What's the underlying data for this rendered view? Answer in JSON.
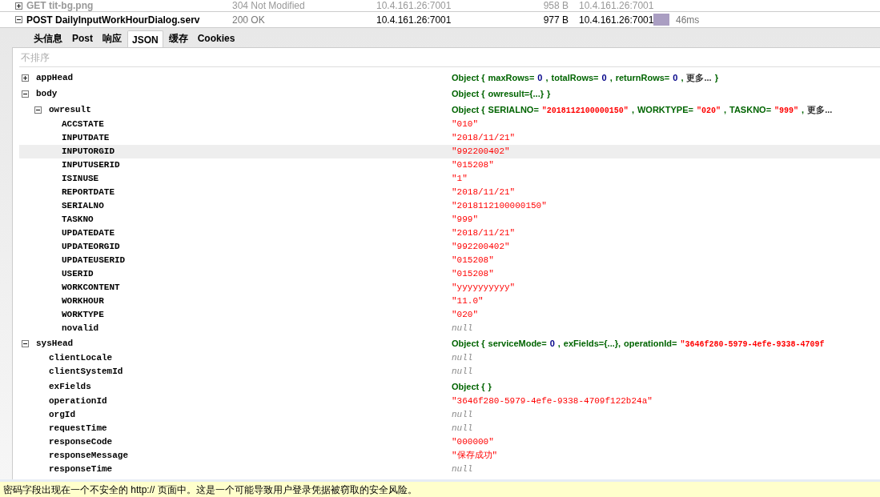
{
  "requests": [
    {
      "method_url": "GET tit-bg.png",
      "status": "304 Not Modified",
      "domain": "10.4.161.26:7001",
      "size": "958 B",
      "remote_ip": "10.4.161.26:7001",
      "expanded": false,
      "dimmed": true
    },
    {
      "method_url": "POST DailyInputWorkHourDialog.serv",
      "status": "200 OK",
      "domain": "10.4.161.26:7001",
      "size": "977 B",
      "remote_ip": "10.4.161.26:7001",
      "expanded": true,
      "dimmed": false,
      "timing": "46ms"
    }
  ],
  "tabs": [
    {
      "label": "头信息",
      "selected": false
    },
    {
      "label": "Post",
      "selected": false
    },
    {
      "label": "响应",
      "selected": false
    },
    {
      "label": "JSON",
      "selected": true
    },
    {
      "label": "缓存",
      "selected": false
    },
    {
      "label": "Cookies",
      "selected": false
    }
  ],
  "sort_toggle": "不排序",
  "tree": [
    {
      "key": "appHead",
      "kind": "object",
      "expanded": false,
      "selected": false,
      "preview": [
        {
          "kind": "label",
          "text": "Object {"
        },
        {
          "kind": "key",
          "text": "maxRows="
        },
        {
          "kind": "number",
          "text": "0"
        },
        {
          "kind": "label",
          "text": ","
        },
        {
          "kind": "key",
          "text": "totalRows="
        },
        {
          "kind": "number",
          "text": "0"
        },
        {
          "kind": "label",
          "text": ","
        },
        {
          "kind": "key",
          "text": "returnRows="
        },
        {
          "kind": "number",
          "text": "0"
        },
        {
          "kind": "label",
          "text": ","
        },
        {
          "kind": "more",
          "text": "更多..."
        },
        {
          "kind": "label",
          "text": "}"
        }
      ]
    },
    {
      "key": "body",
      "kind": "object",
      "expanded": true,
      "selected": false,
      "preview": [
        {
          "kind": "label",
          "text": "Object {"
        },
        {
          "kind": "key",
          "text": "owresult={...}"
        },
        {
          "kind": "label",
          "text": "}"
        }
      ],
      "children": [
        {
          "key": "owresult",
          "kind": "object",
          "expanded": true,
          "selected": false,
          "preview": [
            {
              "kind": "label",
              "text": "Object {"
            },
            {
              "kind": "key",
              "text": "SERIALNO="
            },
            {
              "kind": "string",
              "text": "\"2018112100000150\""
            },
            {
              "kind": "label",
              "text": ","
            },
            {
              "kind": "key",
              "text": "WORKTYPE="
            },
            {
              "kind": "string",
              "text": "\"020\""
            },
            {
              "kind": "label",
              "text": ","
            },
            {
              "kind": "key",
              "text": "TASKNO="
            },
            {
              "kind": "string",
              "text": "\"999\""
            },
            {
              "kind": "label",
              "text": ","
            },
            {
              "kind": "more",
              "text": "更多..."
            }
          ],
          "children": [
            {
              "key": "ACCSTATE",
              "kind": "string",
              "value": "\"010\"",
              "selected": false
            },
            {
              "key": "INPUTDATE",
              "kind": "string",
              "value": "\"2018/11/21\"",
              "selected": false
            },
            {
              "key": "INPUTORGID",
              "kind": "string",
              "value": "\"992200402\"",
              "selected": true
            },
            {
              "key": "INPUTUSERID",
              "kind": "string",
              "value": "\"015208\"",
              "selected": false
            },
            {
              "key": "ISINUSE",
              "kind": "string",
              "value": "\"1\"",
              "selected": false
            },
            {
              "key": "REPORTDATE",
              "kind": "string",
              "value": "\"2018/11/21\"",
              "selected": false
            },
            {
              "key": "SERIALNO",
              "kind": "string",
              "value": "\"2018112100000150\"",
              "selected": false
            },
            {
              "key": "TASKNO",
              "kind": "string",
              "value": "\"999\"",
              "selected": false
            },
            {
              "key": "UPDATEDATE",
              "kind": "string",
              "value": "\"2018/11/21\"",
              "selected": false
            },
            {
              "key": "UPDATEORGID",
              "kind": "string",
              "value": "\"992200402\"",
              "selected": false
            },
            {
              "key": "UPDATEUSERID",
              "kind": "string",
              "value": "\"015208\"",
              "selected": false
            },
            {
              "key": "USERID",
              "kind": "string",
              "value": "\"015208\"",
              "selected": false
            },
            {
              "key": "WORKCONTENT",
              "kind": "string",
              "value": "\"yyyyyyyyyy\"",
              "selected": false
            },
            {
              "key": "WORKHOUR",
              "kind": "string",
              "value": "\"11.0\"",
              "selected": false
            },
            {
              "key": "WORKTYPE",
              "kind": "string",
              "value": "\"020\"",
              "selected": false
            },
            {
              "key": "novalid",
              "kind": "null",
              "value": "null",
              "selected": false
            }
          ]
        }
      ]
    },
    {
      "key": "sysHead",
      "kind": "object",
      "expanded": true,
      "selected": false,
      "preview": [
        {
          "kind": "label",
          "text": "Object {"
        },
        {
          "kind": "key",
          "text": "serviceMode="
        },
        {
          "kind": "number",
          "text": "0"
        },
        {
          "kind": "label",
          "text": ","
        },
        {
          "kind": "key",
          "text": "exFields={...},"
        },
        {
          "kind": "key",
          "text": "operationId="
        },
        {
          "kind": "string",
          "text": "\"3646f280-5979-4efe-9338-4709f"
        }
      ],
      "children": [
        {
          "key": "clientLocale",
          "kind": "null",
          "value": "null",
          "selected": false
        },
        {
          "key": "clientSystemId",
          "kind": "null",
          "value": "null",
          "selected": false
        },
        {
          "key": "exFields",
          "kind": "object",
          "selected": false,
          "preview": [
            {
              "kind": "label",
              "text": "Object {"
            },
            {
              "kind": "label",
              "text": "}"
            }
          ]
        },
        {
          "key": "operationId",
          "kind": "string",
          "value": "\"3646f280-5979-4efe-9338-4709f122b24a\"",
          "selected": false
        },
        {
          "key": "orgId",
          "kind": "null",
          "value": "null",
          "selected": false
        },
        {
          "key": "requestTime",
          "kind": "null",
          "value": "null",
          "selected": false
        },
        {
          "key": "responseCode",
          "kind": "string",
          "value": "\"000000\"",
          "selected": false
        },
        {
          "key": "responseMessage",
          "kind": "string",
          "value": "\"保存成功\"",
          "selected": false
        },
        {
          "key": "responseTime",
          "kind": "null",
          "value": "null",
          "selected": false
        }
      ]
    }
  ],
  "notification": "密码字段出现在一个不安全的 http:// 页面中。这是一个可能导致用户登录凭据被窃取的安全风险。"
}
